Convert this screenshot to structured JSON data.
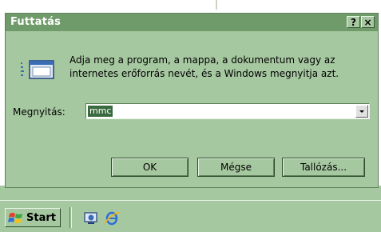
{
  "dialog": {
    "title": "Futtatás",
    "help_label": "?",
    "close_label": "×",
    "instructions": "Adja meg a program, a mappa, a dokumentum vagy az internetes erőforrás nevét, és a Windows megnyitja azt.",
    "open_label": "Megnyitás:",
    "open_value": "mmc",
    "buttons": {
      "ok": "OK",
      "cancel": "Mégse",
      "browse": "Tallózás..."
    }
  },
  "taskbar": {
    "start_label": "Start",
    "quick_launch": [
      "desktop-icon",
      "internet-explorer-icon"
    ]
  },
  "colors": {
    "dialog_bg": "#a6c8a0",
    "titlebar": "#6f9a69",
    "selection": "#3a6b3f"
  }
}
